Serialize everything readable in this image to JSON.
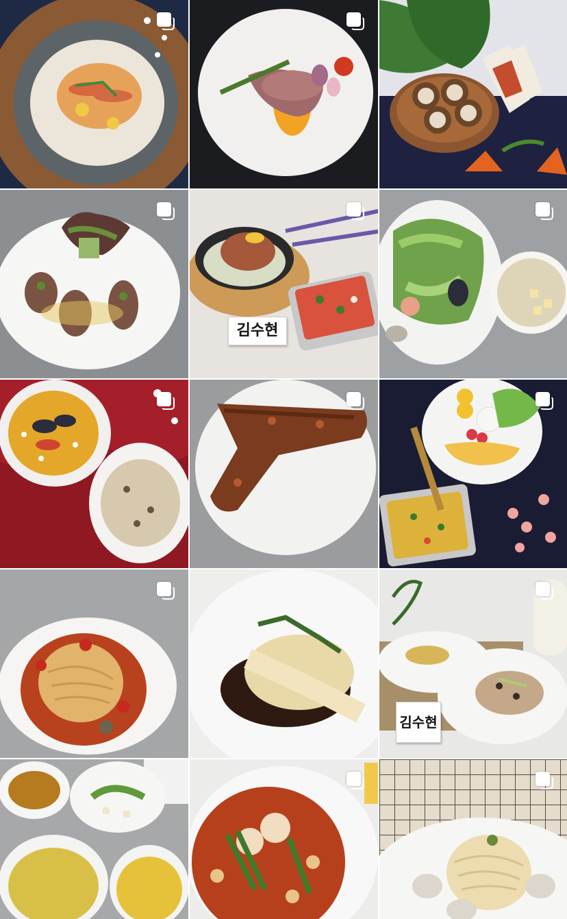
{
  "grid": {
    "columns": 3,
    "background": "#ffffff",
    "posts": [
      {
        "id": "post-1",
        "dish": "shrimp-en-papillote",
        "multi": true
      },
      {
        "id": "post-2",
        "dish": "sliced-duck-breast-with-carrot-puree",
        "multi": true
      },
      {
        "id": "post-3",
        "dish": "cream-rolls-and-wrap",
        "multi": false
      },
      {
        "id": "post-4",
        "dish": "meat-quenelles-with-salad",
        "multi": true
      },
      {
        "id": "post-5",
        "dish": "roast-chicken-skillet-and-salad",
        "multi": true,
        "name_card": "김수현"
      },
      {
        "id": "post-6",
        "dish": "seafood-salad-and-soup",
        "multi": true
      },
      {
        "id": "post-7",
        "dish": "paella-and-risotto",
        "multi": true
      },
      {
        "id": "post-8",
        "dish": "glazed-pork-rib",
        "multi": true
      },
      {
        "id": "post-9",
        "dish": "brunch-plate-and-frittata",
        "multi": true
      },
      {
        "id": "post-10",
        "dish": "tomato-spaghetti",
        "multi": true
      },
      {
        "id": "post-11",
        "dish": "chicken-over-pasta",
        "multi": false
      },
      {
        "id": "post-12",
        "dish": "two-plates-with-name-card",
        "multi": true,
        "name_card": "김수현"
      },
      {
        "id": "post-13",
        "dish": "soups-and-salad",
        "multi": false
      },
      {
        "id": "post-14",
        "dish": "scallops-in-tomato-sauce",
        "multi": true
      },
      {
        "id": "post-15",
        "dish": "clam-vongole-pasta",
        "multi": true
      }
    ]
  },
  "icons": {
    "multi_photo": "multiple-photos-icon"
  },
  "colors": {
    "overlay_icon": "#ffffff"
  }
}
